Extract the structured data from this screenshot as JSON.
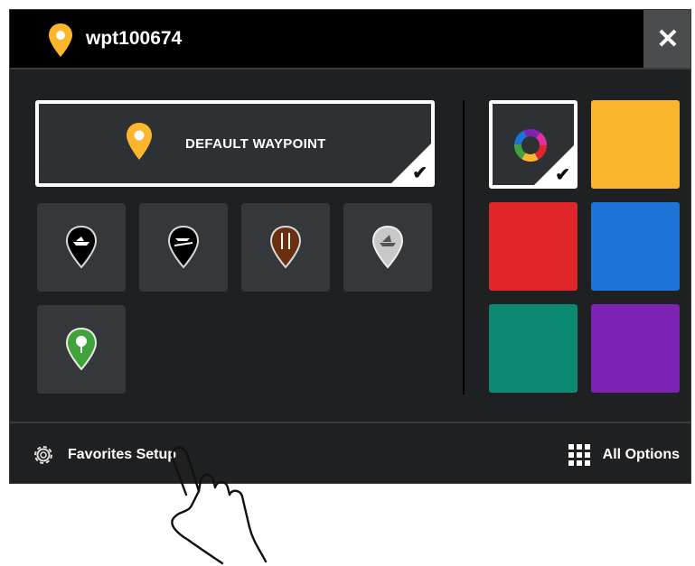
{
  "title": {
    "waypoint_name": "wpt100674",
    "close_label": "✕"
  },
  "default_waypoint": {
    "label": "DEFAULT WAYPOINT",
    "selected": true,
    "check": "✔"
  },
  "icons": [
    {
      "name": "boat-launch",
      "fill": "#000000",
      "stroke": "#d8d8d8"
    },
    {
      "name": "boat-ramp",
      "fill": "#000000",
      "stroke": "#d8d8d8"
    },
    {
      "name": "fishing-lure",
      "fill": "#6b2e10",
      "stroke": "#d8d8d8"
    },
    {
      "name": "marina",
      "fill": "#c8c8c8",
      "stroke": "#d8d8d8"
    },
    {
      "name": "tree",
      "fill": "#3fa23a",
      "stroke": "#d8d8d8"
    }
  ],
  "colors": {
    "multicolor_selected": true,
    "multicolor_check": "✔",
    "swatches": [
      {
        "name": "yellow",
        "hex": "#fbb62b"
      },
      {
        "name": "red",
        "hex": "#e0262a"
      },
      {
        "name": "blue",
        "hex": "#1e73d6"
      },
      {
        "name": "teal",
        "hex": "#0a8a72"
      },
      {
        "name": "purple",
        "hex": "#7e22b3"
      }
    ]
  },
  "bottom": {
    "favorites_label": "Favorites Setup",
    "all_options_label": "All Options"
  },
  "accent": "#fbb62b"
}
